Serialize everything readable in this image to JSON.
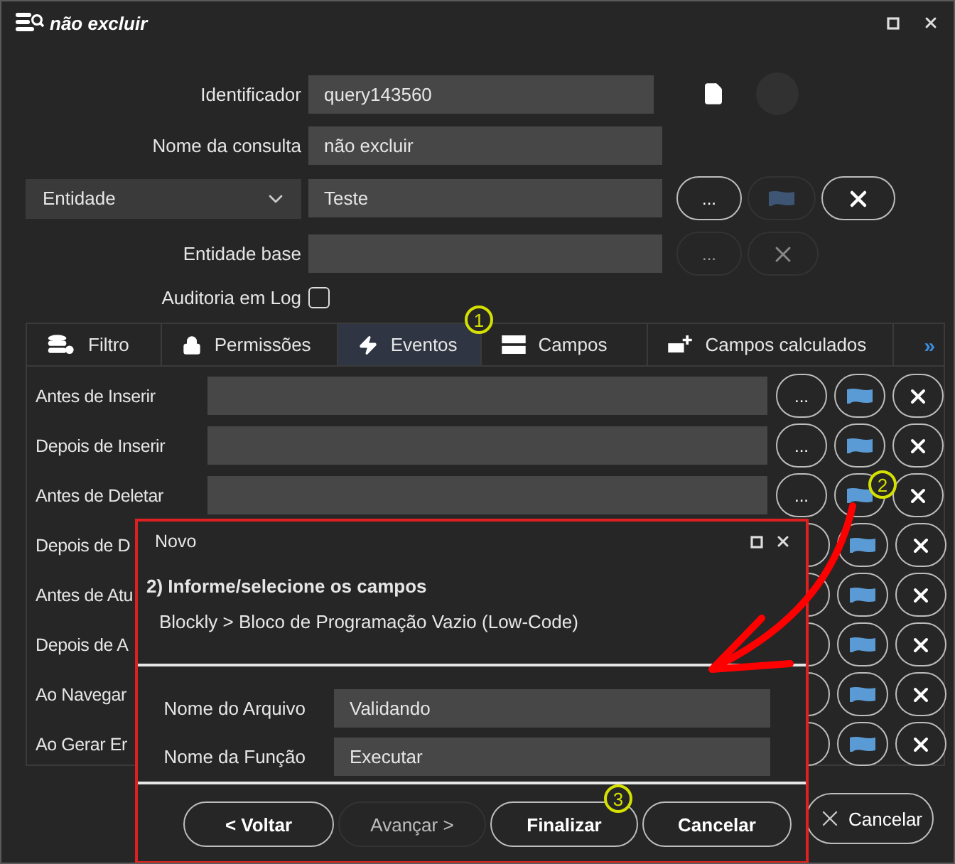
{
  "window": {
    "title": "não excluir"
  },
  "form": {
    "identifier": {
      "label": "Identificador",
      "value": "query143560"
    },
    "query_name": {
      "label": "Nome da consulta",
      "value": "não excluir"
    },
    "entity": {
      "select": "Entidade",
      "value": "Teste",
      "more_button": "..."
    },
    "base_entity": {
      "label": "Entidade base",
      "more_button": "..."
    },
    "audit_log": {
      "label": "Auditoria em Log",
      "checked": false
    }
  },
  "tabs": [
    {
      "label": "Filtro",
      "kind": "filter",
      "selected": false
    },
    {
      "label": "Permissões",
      "kind": "lock",
      "selected": false
    },
    {
      "label": "Eventos",
      "kind": "bolt",
      "selected": true
    },
    {
      "label": "Campos",
      "kind": "fields",
      "selected": false
    },
    {
      "label": "Campos calculados",
      "kind": "calc",
      "selected": false
    }
  ],
  "tabs_overflow": "»",
  "events": [
    {
      "label": "Antes de Inserir",
      "more_button": "..."
    },
    {
      "label": "Depois de Inserir",
      "more_button": "..."
    },
    {
      "label": "Antes de Deletar",
      "more_button": "..."
    },
    {
      "label": "Depois de D"
    },
    {
      "label": "Antes de Atu"
    },
    {
      "label": "Depois de A"
    },
    {
      "label": "Ao Navegar"
    },
    {
      "label": "Ao Gerar Er"
    }
  ],
  "cancel_button": "Cancelar",
  "dialog": {
    "title": "Novo",
    "step": "2) Informe/selecione os campos",
    "path": "Blockly > Bloco de Programação Vazio (Low-Code)",
    "fields": [
      {
        "label": "Nome do Arquivo",
        "value": "Validando"
      },
      {
        "label": "Nome da Função",
        "value": "Executar"
      }
    ],
    "buttons": [
      {
        "label": "< Voltar",
        "disabled": false
      },
      {
        "label": "Avançar >",
        "disabled": true
      },
      {
        "label": "Finalizar",
        "disabled": false
      },
      {
        "label": "Cancelar",
        "disabled": false
      }
    ]
  },
  "annotations": [
    {
      "label": "1"
    },
    {
      "label": "2"
    },
    {
      "label": "3"
    }
  ]
}
